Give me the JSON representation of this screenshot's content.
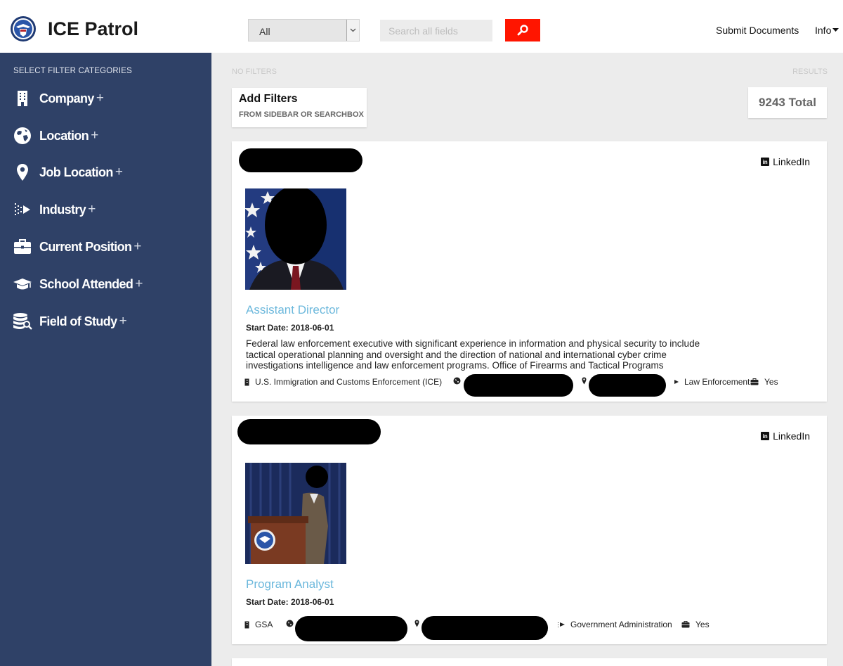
{
  "header": {
    "title": "ICE Patrol",
    "select_value": "All",
    "search_placeholder": "Search all fields",
    "nav": [
      "Submit Documents",
      "Info"
    ]
  },
  "sidebar": {
    "heading": "SELECT FILTER CATEGORIES",
    "items": [
      {
        "label": "Company",
        "icon": "building-icon"
      },
      {
        "label": "Location",
        "icon": "globe-icon"
      },
      {
        "label": "Job Location",
        "icon": "map-pin-icon"
      },
      {
        "label": "Industry",
        "icon": "industry-icon"
      },
      {
        "label": "Current Position",
        "icon": "briefcase-icon"
      },
      {
        "label": "School Attended",
        "icon": "graduation-cap-icon"
      },
      {
        "label": "Field of Study",
        "icon": "database-search-icon"
      }
    ],
    "plus": "+"
  },
  "main": {
    "filters_label": "NO FILTERS",
    "results_label": "RESULTS",
    "add_filters_title": "Add Filters",
    "add_filters_sub": "FROM SIDEBAR OR SEARCHBOX",
    "total": "9243 Total"
  },
  "cards": [
    {
      "linkedin": "LinkedIn",
      "title": "Assistant Director",
      "start_date": "Start Date: 2018-06-01",
      "description": "Federal law enforcement executive with significant experience in information and physical security to include tactical operational planning and oversight and the direction of national and international cyber crime investigations intelligence and law enforcement programs. Office of Firearms and Tactical Programs",
      "company": "U.S. Immigration and Customs Enforcement (ICE)",
      "industry": "Law Enforcement",
      "current": "Yes"
    },
    {
      "linkedin": "LinkedIn",
      "title": "Program Analyst",
      "start_date": "Start Date: 2018-06-01",
      "company": "GSA",
      "industry": "Government Administration",
      "current": "Yes"
    }
  ],
  "colors": {
    "sidebar_bg": "#2f4167",
    "search_button": "#ff1500",
    "job_title": "#6cb8dc",
    "page_bg": "#ececec"
  }
}
